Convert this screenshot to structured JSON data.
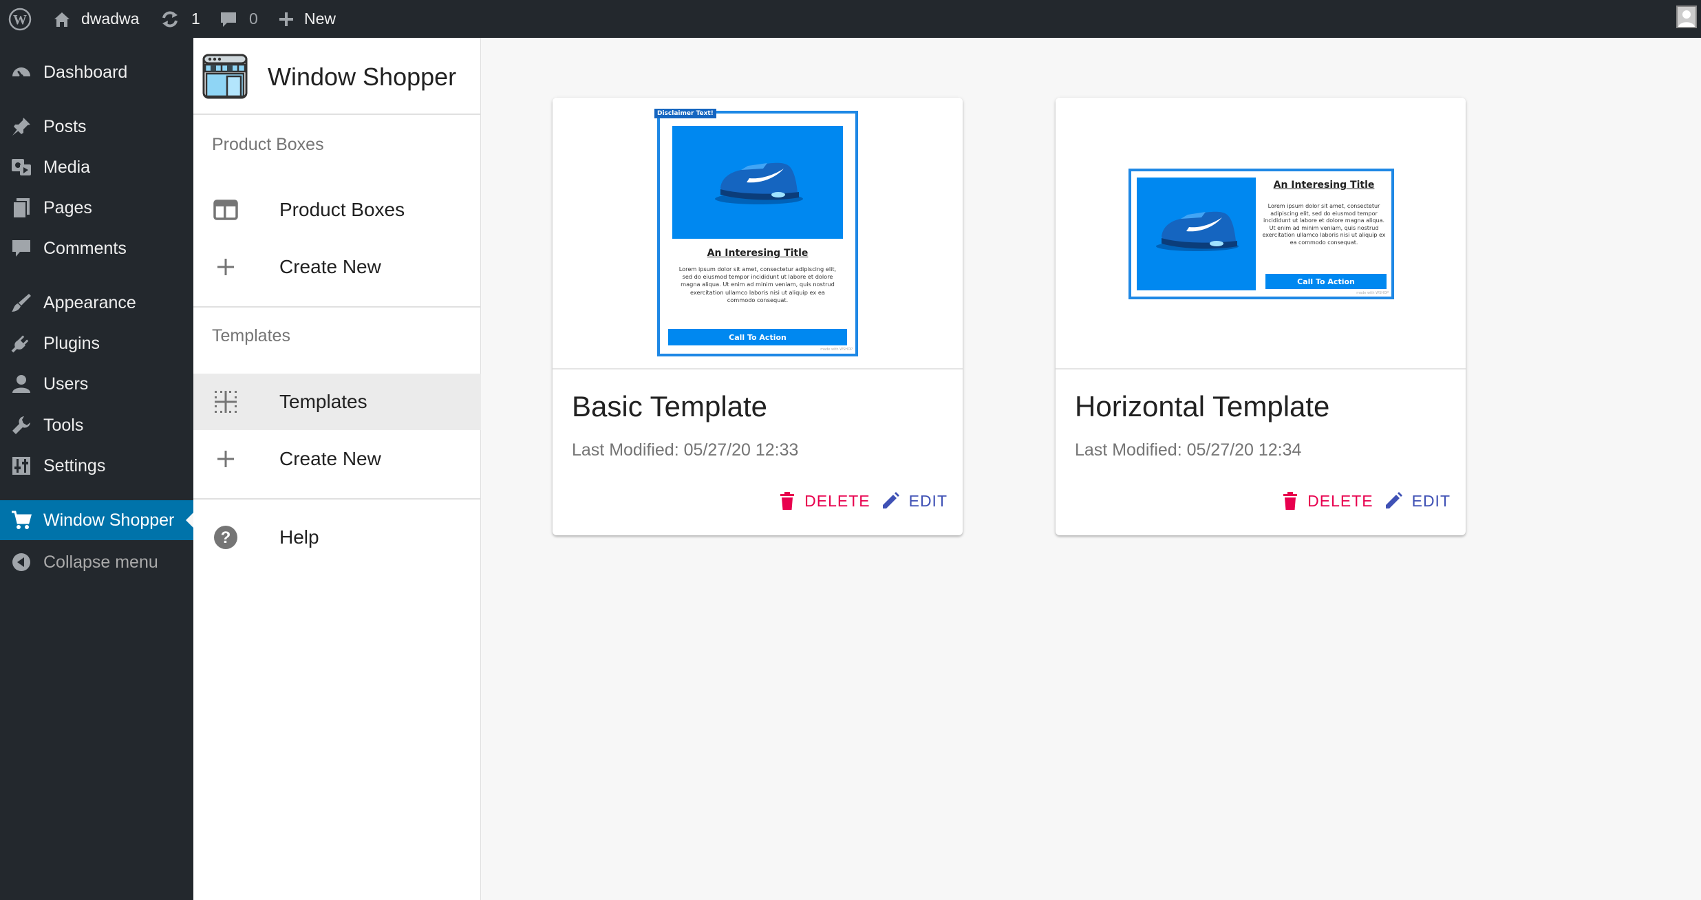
{
  "admin_bar": {
    "site_name": "dwadwa",
    "updates_count": "1",
    "comments_count": "0",
    "new_label": "New"
  },
  "admin_menu": {
    "items": [
      {
        "label": "Dashboard",
        "icon": "dashboard-icon"
      },
      {
        "label": "Posts",
        "icon": "pin-icon"
      },
      {
        "label": "Media",
        "icon": "media-icon"
      },
      {
        "label": "Pages",
        "icon": "pages-icon"
      },
      {
        "label": "Comments",
        "icon": "comment-icon"
      },
      {
        "label": "Appearance",
        "icon": "brush-icon"
      },
      {
        "label": "Plugins",
        "icon": "plug-icon"
      },
      {
        "label": "Users",
        "icon": "user-icon"
      },
      {
        "label": "Tools",
        "icon": "wrench-icon"
      },
      {
        "label": "Settings",
        "icon": "sliders-icon"
      },
      {
        "label": "Window Shopper",
        "icon": "cart-icon",
        "current": true
      },
      {
        "label": "Collapse menu",
        "icon": "collapse-icon"
      }
    ],
    "current_color": "#0073aa"
  },
  "plugin_nav": {
    "title": "Window Shopper",
    "sections": [
      {
        "header": "Product Boxes",
        "items": [
          {
            "label": "Product Boxes",
            "icon": "web-layout-icon"
          },
          {
            "label": "Create New",
            "icon": "plus-icon"
          }
        ]
      },
      {
        "header": "Templates",
        "items": [
          {
            "label": "Templates",
            "icon": "grid-icon",
            "selected": true
          },
          {
            "label": "Create New",
            "icon": "plus-icon"
          }
        ]
      }
    ],
    "help_label": "Help"
  },
  "cards": [
    {
      "title": "Basic Template",
      "modified": "Last Modified: 05/27/20 12:33",
      "delete_label": "DELETE",
      "edit_label": "EDIT",
      "preview": {
        "layout": "vertical",
        "disclaimer": "Disclaimer Text!",
        "heading": "An Interesing Title",
        "body": "Lorem ipsum dolor sit amet, consectetur adipiscing elit, sed do eiusmod tempor incididunt ut labore et dolore magna aliqua. Ut enim ad minim veniam, quis nostrud exercitation ullamco laboris nisi ut aliquip ex ea commodo consequat.",
        "cta": "Call To Action",
        "footer": "made with WSHOP"
      }
    },
    {
      "title": "Horizontal Template",
      "modified": "Last Modified: 05/27/20 12:34",
      "delete_label": "DELETE",
      "edit_label": "EDIT",
      "preview": {
        "layout": "horizontal",
        "heading": "An Interesing Title",
        "body": "Lorem ipsum dolor sit amet, consectetur adipiscing elit, sed do eiusmod tempor incididunt ut labore et dolore magna aliqua. Ut enim ad minim veniam, quis nostrud exercitation ullamco laboris nisi ut aliquip ex ea commodo consequat.",
        "cta": "Call To Action",
        "footer": "made with WSHOP"
      }
    }
  ],
  "colors": {
    "delete": "#e8004e",
    "edit": "#3f51b5",
    "preview_blue": "#0088f0"
  }
}
